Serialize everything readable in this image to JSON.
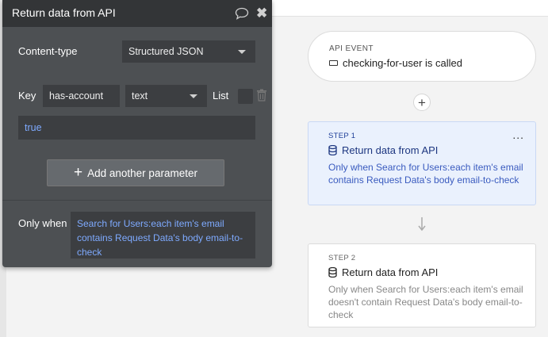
{
  "panel": {
    "title": "Return data from API",
    "content_type_label": "Content-type",
    "content_type_value": "Structured JSON",
    "key_label": "Key",
    "key_value": "has-account",
    "type_value": "text",
    "list_label": "List",
    "value_field": "true",
    "add_param_label": "Add another parameter",
    "only_when_label": "Only when",
    "only_when_value": "Search for Users:each item's email contains Request Data's body email-to-check"
  },
  "workflow": {
    "event": {
      "caption": "API EVENT",
      "title": "checking-for-user is called"
    },
    "steps": [
      {
        "caption": "STEP 1",
        "title": "Return data from API",
        "description": "Only when Search for Users:each item's email contains Request Data's body email-to-check",
        "menu": "..."
      },
      {
        "caption": "STEP 2",
        "title": "Return data from API",
        "description": "Only when Search for Users:each item's email doesn't contain Request Data's body email-to-check"
      }
    ]
  },
  "colors": {
    "panel_bg": "#4d5053",
    "panel_header": "#333537",
    "link_blue": "#7eaaff",
    "active_step_bg": "#eaf1fd"
  }
}
